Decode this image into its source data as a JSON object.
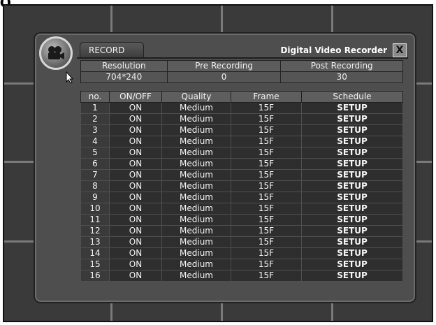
{
  "page": {
    "corner_glyph": "Q"
  },
  "window": {
    "tab_label": "RECORD",
    "title": "Digital Video Recorder",
    "close_label": "X"
  },
  "icons": {
    "logo": "video-camera-icon",
    "close": "close-icon",
    "cursor": "mouse-pointer-icon"
  },
  "summary": {
    "headers": [
      "Resolution",
      "Pre Recording",
      "Post Recording"
    ],
    "values": [
      "704*240",
      "0",
      "30"
    ]
  },
  "table": {
    "headers": [
      "no.",
      "ON/OFF",
      "Quality",
      "Frame",
      "Schedule"
    ],
    "rows": [
      [
        "1",
        "ON",
        "Medium",
        "15F",
        "SETUP"
      ],
      [
        "2",
        "ON",
        "Medium",
        "15F",
        "SETUP"
      ],
      [
        "3",
        "ON",
        "Medium",
        "15F",
        "SETUP"
      ],
      [
        "4",
        "ON",
        "Medium",
        "15F",
        "SETUP"
      ],
      [
        "5",
        "ON",
        "Medium",
        "15F",
        "SETUP"
      ],
      [
        "6",
        "ON",
        "Medium",
        "15F",
        "SETUP"
      ],
      [
        "7",
        "ON",
        "Medium",
        "15F",
        "SETUP"
      ],
      [
        "8",
        "ON",
        "Medium",
        "15F",
        "SETUP"
      ],
      [
        "9",
        "ON",
        "Medium",
        "15F",
        "SETUP"
      ],
      [
        "10",
        "ON",
        "Medium",
        "15F",
        "SETUP"
      ],
      [
        "11",
        "ON",
        "Medium",
        "15F",
        "SETUP"
      ],
      [
        "12",
        "ON",
        "Medium",
        "15F",
        "SETUP"
      ],
      [
        "13",
        "ON",
        "Medium",
        "15F",
        "SETUP"
      ],
      [
        "14",
        "ON",
        "Medium",
        "15F",
        "SETUP"
      ],
      [
        "15",
        "ON",
        "Medium",
        "15F",
        "SETUP"
      ],
      [
        "16",
        "ON",
        "Medium",
        "15F",
        "SETUP"
      ]
    ]
  }
}
